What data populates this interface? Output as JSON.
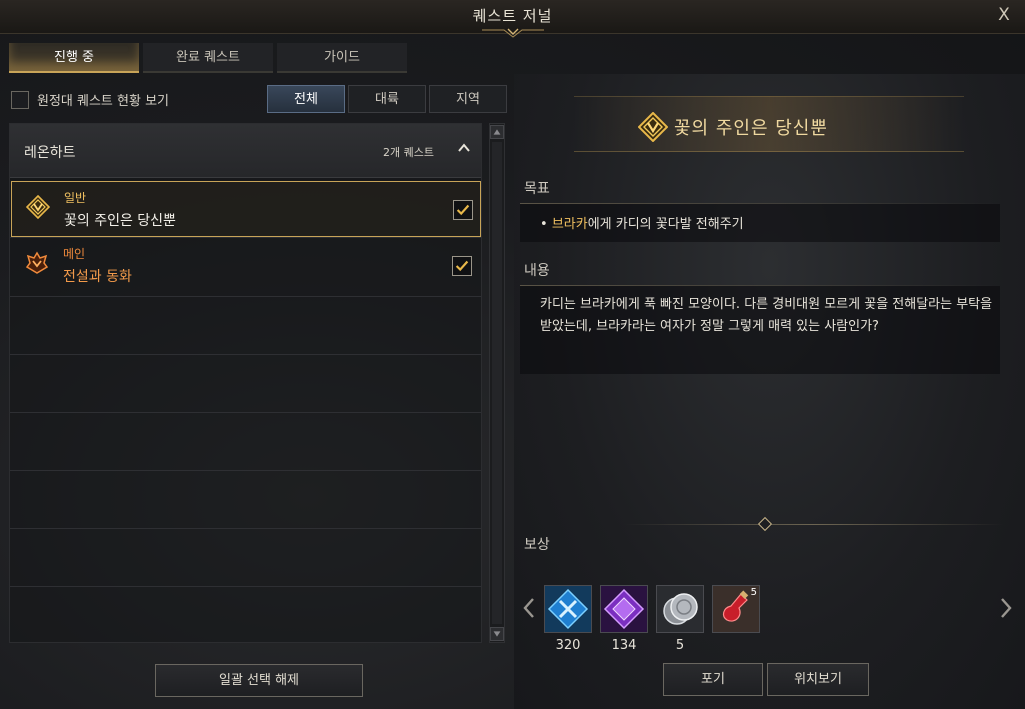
{
  "window": {
    "title": "퀘스트 저널"
  },
  "tabs": [
    {
      "label": "진행 중",
      "active": true
    },
    {
      "label": "완료 퀘스트",
      "active": false
    },
    {
      "label": "가이드",
      "active": false
    }
  ],
  "filter": {
    "expedition_label": "원정대 퀘스트 현황 보기",
    "options": [
      {
        "label": "전체",
        "active": true
      },
      {
        "label": "대륙",
        "active": false
      },
      {
        "label": "지역",
        "active": false
      }
    ]
  },
  "quest_group": {
    "name": "레온하트",
    "count_label": "2개 퀘스트",
    "quests": [
      {
        "type": "일반",
        "title": "꽃의 주인은 당신뿐",
        "checked": true,
        "selected": true,
        "icon": "general-quest-icon",
        "type_color": "#f0c060",
        "title_color": "#f4f1ea"
      },
      {
        "type": "메인",
        "title": "전설과 동화",
        "checked": true,
        "selected": false,
        "icon": "main-quest-icon",
        "type_color": "#f08a3c",
        "title_color": "#f29a4a"
      }
    ]
  },
  "bulk_deselect_label": "일괄 선택 해제",
  "detail": {
    "title": "꽃의 주인은 당신뿐",
    "objective_label": "목표",
    "objective": {
      "bullet": "•",
      "npc": "브라카",
      "rest": "에게 카디의 꽃다발 전해주기"
    },
    "content_label": "내용",
    "content_text": "카디는 브라카에게 푹 빠진 모양이다. 다른 경비대원 모르게 꽃을 전해달라는 부탁을 받았는데, 브라카라는 여자가 정말 그렇게 매력 있는 사람인가?",
    "reward_label": "보상",
    "rewards": [
      {
        "icon": "blue-cross-gem-icon",
        "value": "320"
      },
      {
        "icon": "purple-diamond-gem-icon",
        "value": "134"
      },
      {
        "icon": "silver-coin-icon",
        "value": "5"
      },
      {
        "icon": "red-potion-icon",
        "value": "",
        "badge": "5"
      }
    ],
    "buttons": {
      "abandon": "포기",
      "locate": "위치보기"
    }
  },
  "colors": {
    "accent_gold": "#c8a458",
    "active_filter": "#39475a"
  }
}
